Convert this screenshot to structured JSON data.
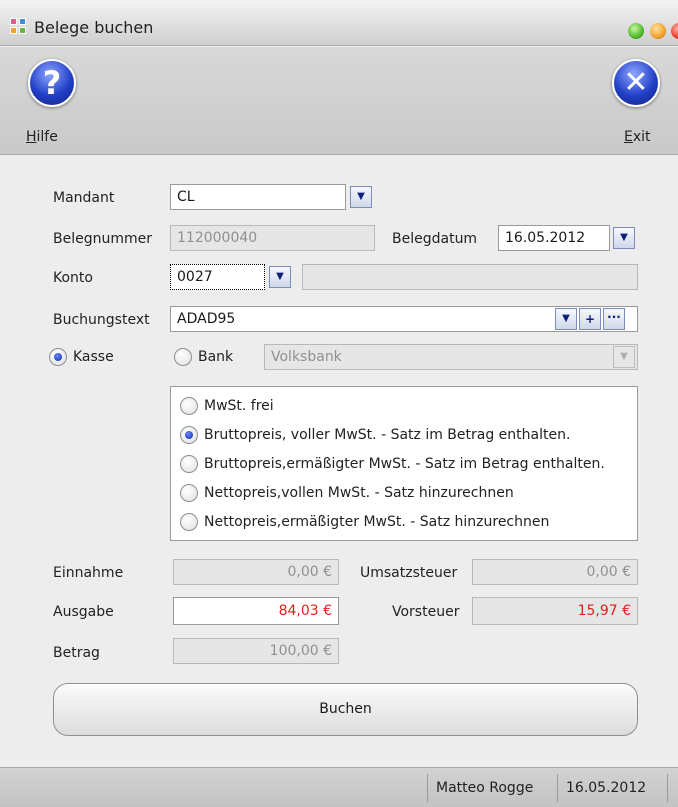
{
  "window": {
    "title": "Belege buchen"
  },
  "toolbar": {
    "help": {
      "mnemonic": "H",
      "rest": "ilfe",
      "icon": "help-icon"
    },
    "exit": {
      "mnemonic": "E",
      "rest": "xit",
      "icon": "close-icon"
    }
  },
  "form": {
    "mandant": {
      "label": "Mandant",
      "value": "CL"
    },
    "belegnummer": {
      "label": "Belegnummer",
      "value": "112000040"
    },
    "belegdatum": {
      "label": "Belegdatum",
      "value": "16.05.2012"
    },
    "konto": {
      "label": "Konto",
      "value": "0027",
      "name_value": ""
    },
    "buchungstext": {
      "label": "Buchungstext",
      "value": "ADAD95"
    },
    "payment": {
      "kasse_label": "Kasse",
      "bank_label": "Bank",
      "selected": "kasse",
      "bank_value": "Volksbank"
    },
    "mwst_options": [
      {
        "label": "MwSt. frei",
        "checked": false
      },
      {
        "label": "Bruttopreis, voller MwSt. - Satz im Betrag enthalten.",
        "checked": true
      },
      {
        "label": "Bruttopreis,ermäßigter MwSt. - Satz im Betrag enthalten.",
        "checked": false
      },
      {
        "label": "Nettopreis,vollen MwSt. - Satz hinzurechnen",
        "checked": false
      },
      {
        "label": "Nettopreis,ermäßigter MwSt. - Satz hinzurechnen",
        "checked": false
      }
    ],
    "einnahme": {
      "label": "Einnahme",
      "value": "0,00 €"
    },
    "umsatzsteuer": {
      "label": "Umsatzsteuer",
      "value": "0,00 €"
    },
    "ausgabe": {
      "label": "Ausgabe",
      "value": "84,03 €"
    },
    "vorsteuer": {
      "label": "Vorsteuer",
      "value": "15,97 €"
    },
    "betrag": {
      "label": "Betrag",
      "value": "100,00 €"
    },
    "submit_label": "Buchen"
  },
  "status": {
    "user": "Matteo Rogge",
    "date": "16.05.2012"
  },
  "glyphs": {
    "dropdown": "▼",
    "plus": "+",
    "more": "···"
  },
  "colors": {
    "accent_blue": "#1f3ec4",
    "negative_red": "#e0211b"
  }
}
